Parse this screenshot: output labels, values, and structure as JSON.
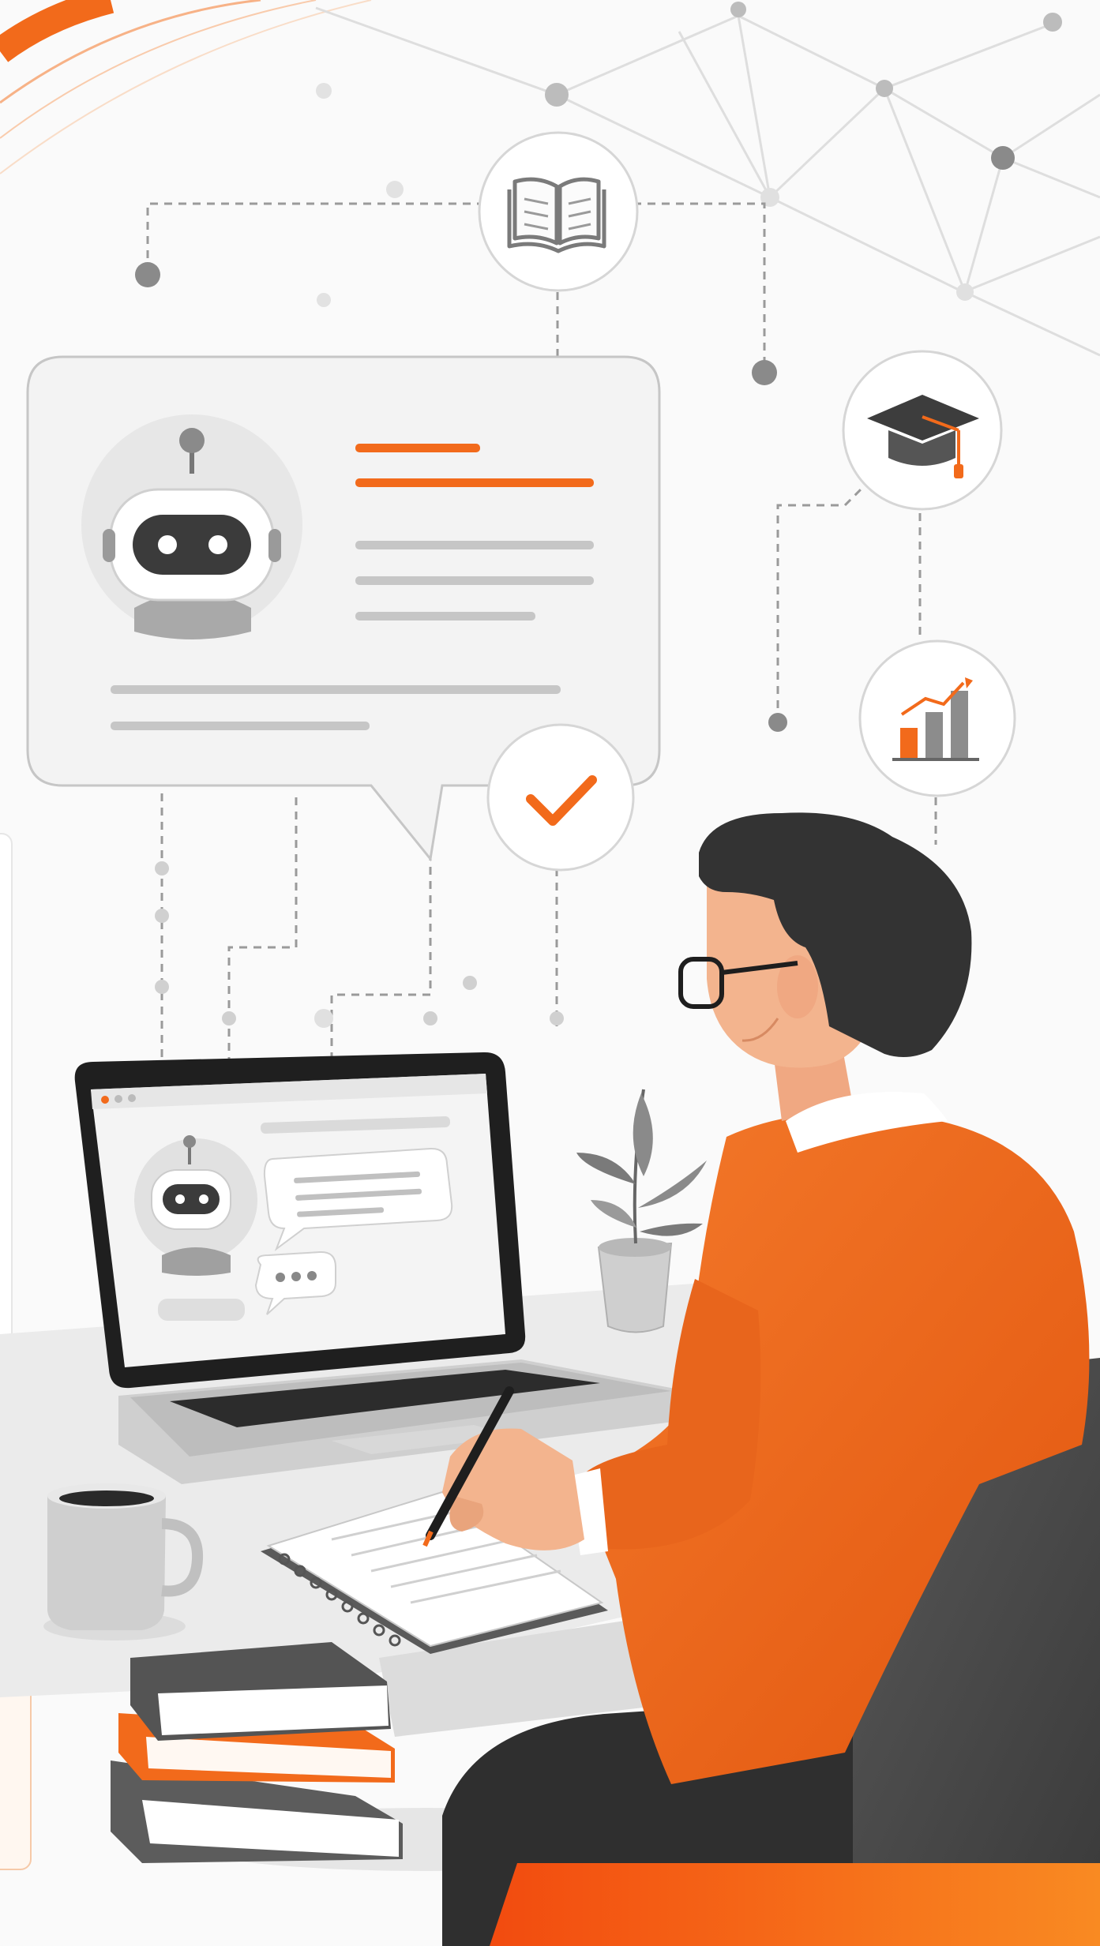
{
  "illustration": {
    "subject": "person-using-ai-chatbot-on-laptop",
    "palette": {
      "accent": "#f26a1b",
      "accent_dark": "#e0560f",
      "hair": "#333333",
      "chair": "#4a4a4a",
      "pants": "#2f2f2f",
      "skin": "#f3b48e",
      "line_gray": "#c8c8c8",
      "bubble_fill": "#f4f4f4"
    },
    "icons": [
      "book-icon",
      "graduation-cap-icon",
      "bar-chart-icon",
      "check-icon",
      "robot-avatar-icon",
      "coffee-mug-icon",
      "plant-icon",
      "pen-icon",
      "notebook-icon"
    ]
  }
}
